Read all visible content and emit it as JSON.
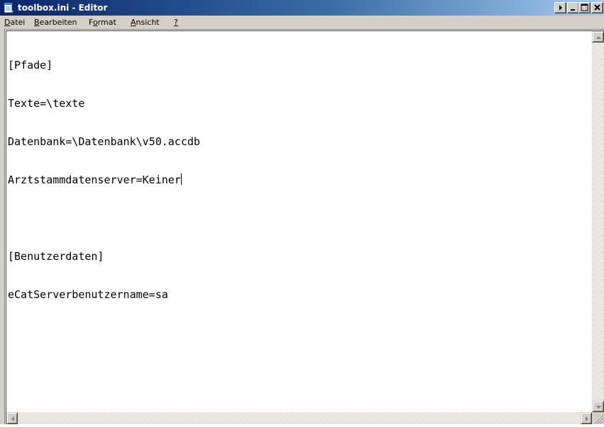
{
  "window": {
    "title": "toolbox.ini - Editor",
    "icon": "notepad-icon"
  },
  "title_buttons": [
    "help-arrow-icon",
    "minimize-icon",
    "maximize-icon",
    "close-icon"
  ],
  "menu": [
    {
      "label": "Datei",
      "access_key": "D"
    },
    {
      "label": "Bearbeiten",
      "access_key": "B"
    },
    {
      "label": "Format",
      "access_key": "o"
    },
    {
      "label": "Ansicht",
      "access_key": "A"
    },
    {
      "label": "?",
      "access_key": "?"
    }
  ],
  "document": {
    "lines": [
      "[Pfade]",
      "Texte=\\texte",
      "Datenbank=\\Datenbank\\v50.accdb",
      "Arztstammdatenserver=Keiner",
      "",
      "[Benutzerdaten]",
      "eCatServerbenutzername=sa"
    ]
  },
  "colors": {
    "titlebar_start": "#0a246a",
    "titlebar_end": "#a6caf0",
    "chrome": "#d4d0c8",
    "editor_bg": "#ffffff"
  }
}
